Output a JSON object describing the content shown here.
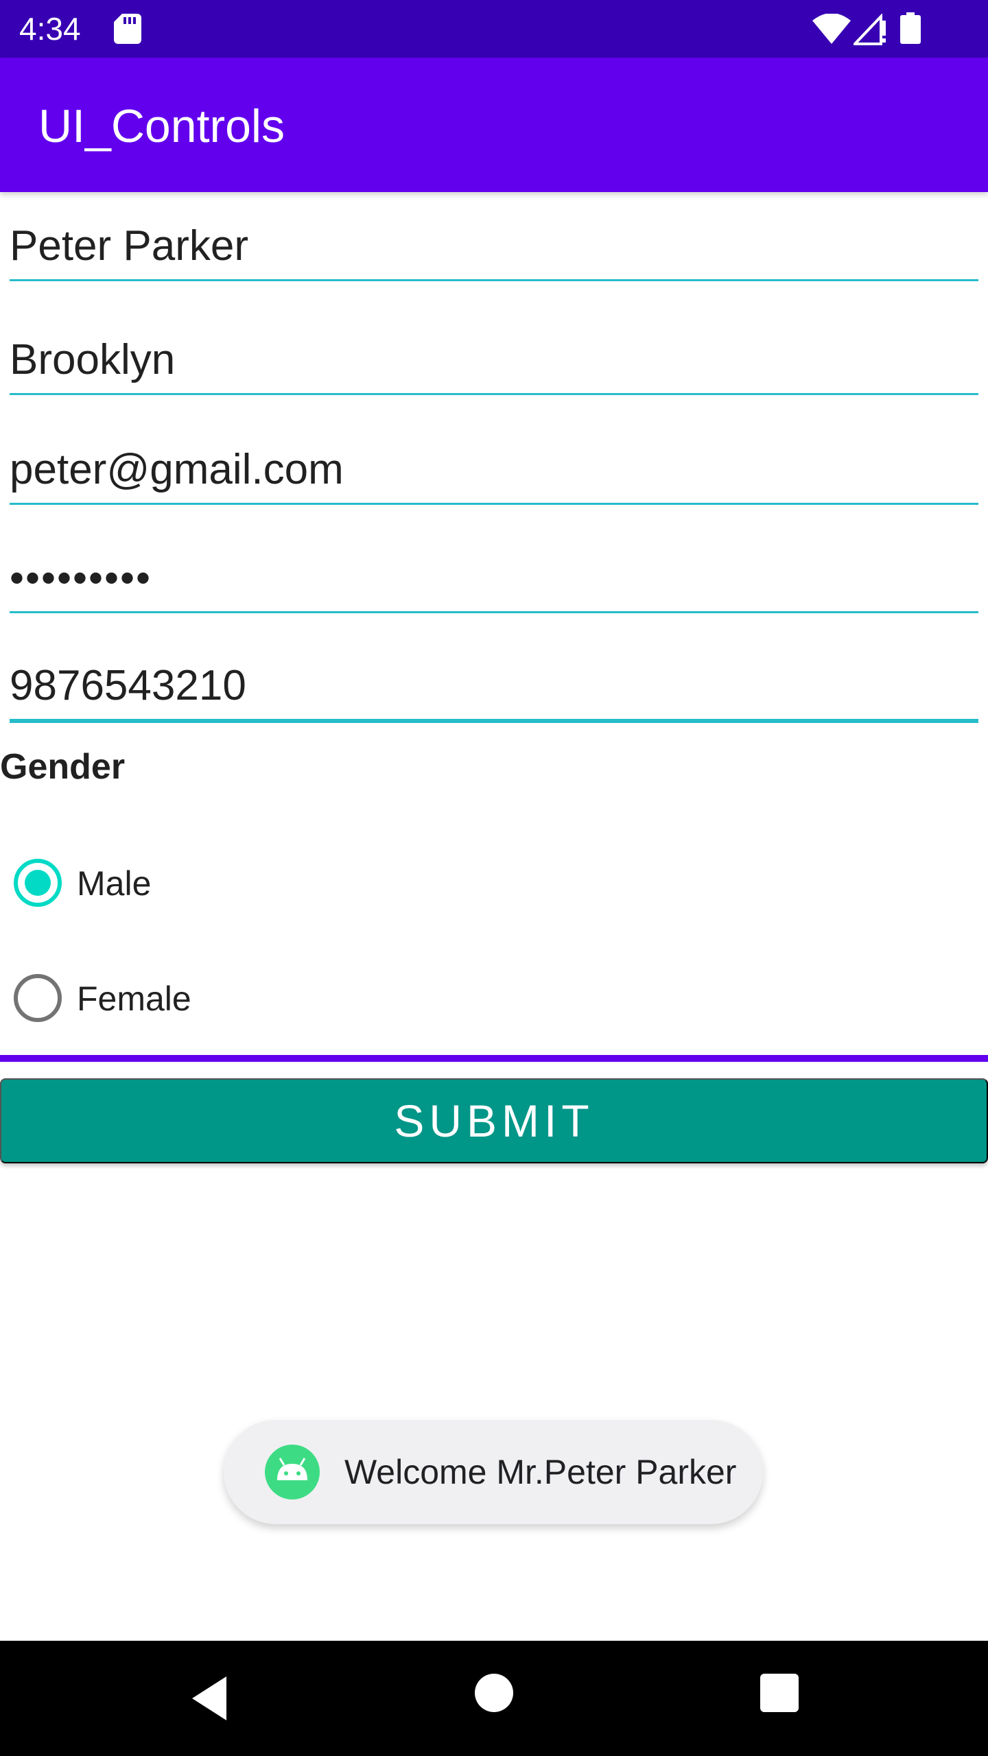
{
  "status_bar": {
    "time": "4:34",
    "icons": [
      "sd-card-icon",
      "wifi-icon",
      "signal-icon",
      "battery-icon"
    ]
  },
  "app_bar": {
    "title": "UI_Controls"
  },
  "form": {
    "name": "Peter Parker",
    "city": "Brooklyn",
    "email": "peter@gmail.com",
    "password_masked": "•••••••••",
    "phone": "9876543210",
    "gender_label": "Gender",
    "options": [
      {
        "label": "Male",
        "checked": true
      },
      {
        "label": "Female",
        "checked": false
      }
    ],
    "submit_label": "SUBMIT"
  },
  "toast": {
    "message": "Welcome Mr.Peter Parker"
  },
  "nav_bar": {
    "icons": [
      "back-icon",
      "home-icon",
      "recents-icon"
    ]
  },
  "colors": {
    "status_bar": "#3700B3",
    "app_bar": "#6200EE",
    "field_underline": "#26BCC9",
    "radio_accent": "#03DAC5",
    "submit_button": "#009688",
    "toast_bg": "#F0F0F2"
  }
}
